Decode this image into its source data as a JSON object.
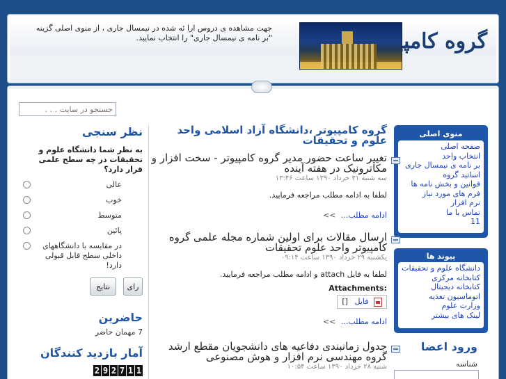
{
  "header": {
    "site_title": "گروه کامپیوتر",
    "notice": "جهت مشاهده ی دروس ارا ئه شده در نیمسال جاری ، از منوی اصلی گزینه \"بر نامه ی نیمسال جاری\" را انتخاب نمایید."
  },
  "search": {
    "placeholder": "جستجو در سایت . . ."
  },
  "main_menu": {
    "title": "منوی اصلی",
    "items": [
      "صفحه اصلی",
      "انتخاب واحد",
      "بر نامه ی نیمسال جاری",
      "اساتید گروه",
      "قوانین و بخش نامه ها",
      "فرم های مورد نیاز",
      "نرم افزار",
      "تماس با ما",
      "11"
    ]
  },
  "links": {
    "title": "پیوند ها",
    "items": [
      "دانشگاه علوم و تحقیقات",
      "کتابخانه مرکزی",
      "کتابخانه دیجیتال",
      "اتوماسیون تغذیه",
      "وزارت علوم",
      "لینک های بیشتر"
    ]
  },
  "login": {
    "title": "ورود اعضا",
    "username_label": "شناسه"
  },
  "main": {
    "heading": "گروه کامپیوتر ،دانشگاه آزاد اسلامی واحد علوم و تحقیقات",
    "articles": [
      {
        "title": "تغییر ساعت حضور مدیر گروه کامپیوتر - سخت افزار و مکاترونیک در هفته آینده",
        "date": "سه شنبه ۳۱ خرداد ۱۳۹۰ ساعت ۱۳:۴۶",
        "body": "لطفا به ادامه مطلب مراجعه فرمایید.",
        "more": "ادامه مطلب...",
        "more_arrow": ">>"
      },
      {
        "title": "ارسال مقالات برای اولین شماره مجله علمی گروه کامپیوتر واحد علوم تحقیقات",
        "date": "یکشنبه ۲۹ خرداد ۱۳۹۰ ساعت ۰۹:۱۴",
        "body": "لطفا به فایل attach و ادامه مطلب مراجعه فرمایید.",
        "attachments_label": "Attachments:",
        "attachment_name": "فایل",
        "attachment_size": "[]",
        "more": "ادامه مطلب...",
        "more_arrow": ">>"
      },
      {
        "title": "جدول زمانبندی دفاعیه های دانشجویان مقطع ارشد گروه مهندسی نرم افزار و هوش مصنوعی",
        "date": "شنبه ۲۸ خرداد ۱۳۹۰ ساعت ۱۰:۵۴"
      }
    ]
  },
  "poll": {
    "title": "نظر سنجی",
    "question": "به نظر شما دانشگاه علوم و تحقیقات در چه سطح علمی قرار دارد؟",
    "options": [
      "عالی",
      "خوب",
      "متوسط",
      "پائین",
      "در مقایسه با دانشگاههای داخلی سطح قابل قبولی دارد!"
    ],
    "vote_label": "رای",
    "results_label": "نتایج"
  },
  "online": {
    "title": "حاضرین",
    "text": "7 مهمان حاضر"
  },
  "stats": {
    "title": "آمار بازدید کنندگان",
    "counter_digits": [
      "2",
      "9",
      "2",
      "7",
      "1",
      "1"
    ]
  }
}
